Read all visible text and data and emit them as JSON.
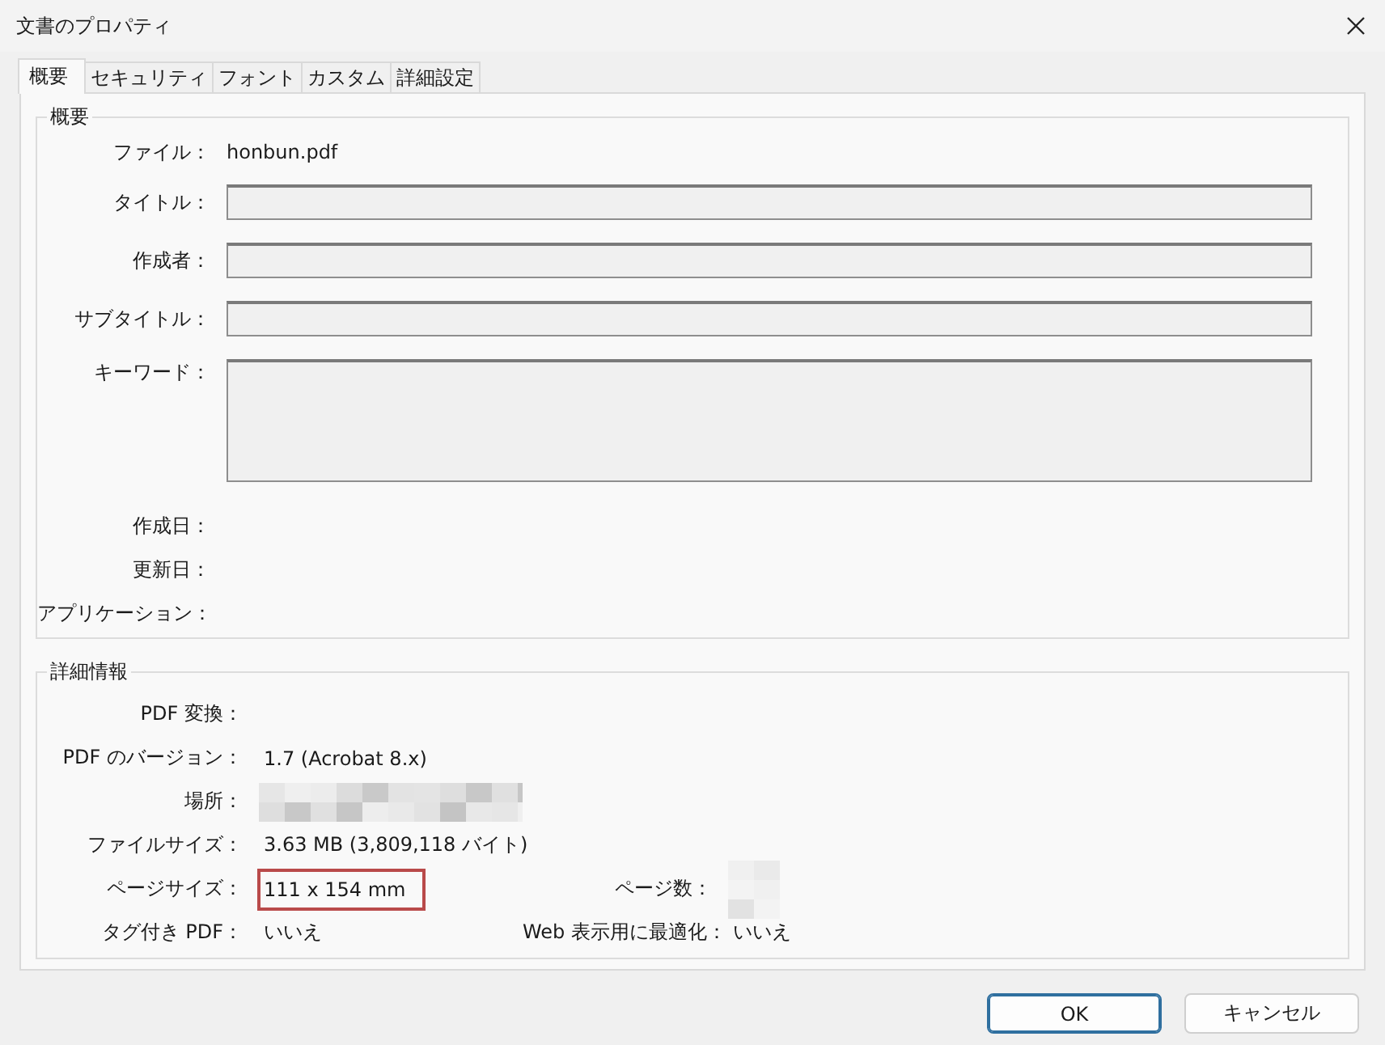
{
  "window": {
    "title": "文書のプロパティ"
  },
  "tabs": [
    {
      "label": "概要",
      "selected": true
    },
    {
      "label": "セキュリティ",
      "selected": false
    },
    {
      "label": "フォント",
      "selected": false
    },
    {
      "label": "カスタム",
      "selected": false
    },
    {
      "label": "詳細設定",
      "selected": false
    }
  ],
  "summary": {
    "legend": "概要",
    "fields": [
      {
        "label": "ファイル：",
        "kind": "text",
        "value": "honbun.pdf"
      },
      {
        "label": "タイトル：",
        "kind": "input"
      },
      {
        "label": "作成者：",
        "kind": "input"
      },
      {
        "label": "サブタイトル：",
        "kind": "input"
      },
      {
        "label": "キーワード：",
        "kind": "textarea"
      },
      {
        "label": "作成日：",
        "kind": "text"
      },
      {
        "label": "更新日：",
        "kind": "text"
      },
      {
        "label": "アプリケーション：",
        "kind": "text"
      }
    ]
  },
  "details": {
    "legend": "詳細情報",
    "rows": [
      [
        {
          "label": "PDF 変換：",
          "kind": "text"
        }
      ],
      [
        {
          "label": "PDF のバージョン：",
          "kind": "text",
          "value": "1.7 (Acrobat 8.x)"
        }
      ],
      [
        {
          "label": "場所：",
          "kind": "redacted"
        }
      ],
      [
        {
          "label": "ファイルサイズ：",
          "kind": "text",
          "value": "3.63 MB (3,809,118 バイト)"
        }
      ],
      [
        {
          "label": "ページサイズ：",
          "kind": "text",
          "value": "111 x 154 mm",
          "highlighted": true
        },
        {
          "label": "ページ数：",
          "kind": "redacted-small"
        }
      ],
      [
        {
          "label": "タグ付き PDF：",
          "kind": "text",
          "value": "いいえ"
        },
        {
          "label": "Web 表示用に最適化：",
          "kind": "text",
          "value": "いいえ"
        }
      ]
    ]
  },
  "buttons": [
    {
      "label": "OK",
      "default": true
    },
    {
      "label": "キャンセル",
      "default": false
    }
  ]
}
